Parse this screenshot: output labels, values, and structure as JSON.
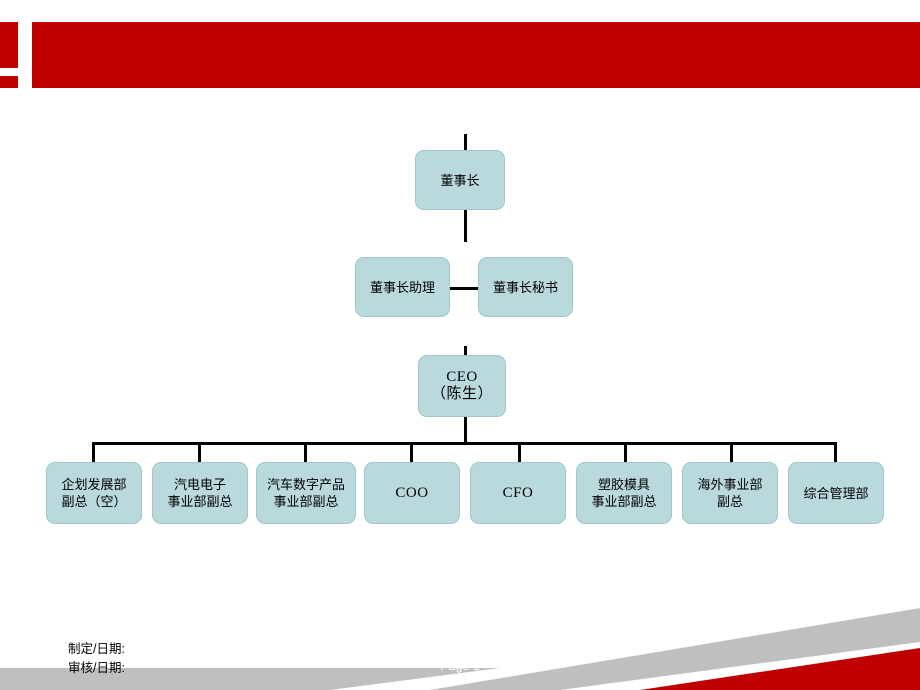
{
  "slide": {
    "banner_color": "#c00000",
    "node_fill": "#b9d9dd",
    "node_border": "#9ec6cb",
    "page_label": "Page 1",
    "footer_line1": "制定/日期:",
    "footer_line2": "审核/日期:"
  },
  "chart_data": {
    "type": "diagram",
    "title": "",
    "nodes": [
      {
        "id": "chairman",
        "label": "董事长",
        "level": 0
      },
      {
        "id": "chairman-asst",
        "label": "董事长助理",
        "level": 1
      },
      {
        "id": "chairman-sec",
        "label": "董事长秘书",
        "level": 1
      },
      {
        "id": "ceo",
        "label": "CEO\n（陈生）",
        "level": 2
      },
      {
        "id": "plan-dept",
        "label": "企划发展部\n副总（空）",
        "level": 3
      },
      {
        "id": "auto-elec",
        "label": "汽电电子\n事业部副总",
        "level": 3
      },
      {
        "id": "auto-digital",
        "label": "汽车数字产品\n事业部副总",
        "level": 3
      },
      {
        "id": "coo",
        "label": "COO",
        "level": 3
      },
      {
        "id": "cfo",
        "label": "CFO",
        "level": 3
      },
      {
        "id": "plastic-mold",
        "label": "塑胶模具\n事业部副总",
        "level": 3
      },
      {
        "id": "overseas",
        "label": "海外事业部\n副总",
        "level": 3
      },
      {
        "id": "general-admin",
        "label": "综合管理部",
        "level": 3
      }
    ],
    "edges": [
      {
        "from": "chairman",
        "to": "ceo"
      },
      {
        "from": "ceo",
        "to": "chairman-asst"
      },
      {
        "from": "ceo",
        "to": "chairman-sec"
      },
      {
        "from": "ceo",
        "to": "plan-dept"
      },
      {
        "from": "ceo",
        "to": "auto-elec"
      },
      {
        "from": "ceo",
        "to": "auto-digital"
      },
      {
        "from": "ceo",
        "to": "coo"
      },
      {
        "from": "ceo",
        "to": "cfo"
      },
      {
        "from": "ceo",
        "to": "plastic-mold"
      },
      {
        "from": "ceo",
        "to": "overseas"
      },
      {
        "from": "ceo",
        "to": "general-admin"
      }
    ]
  }
}
